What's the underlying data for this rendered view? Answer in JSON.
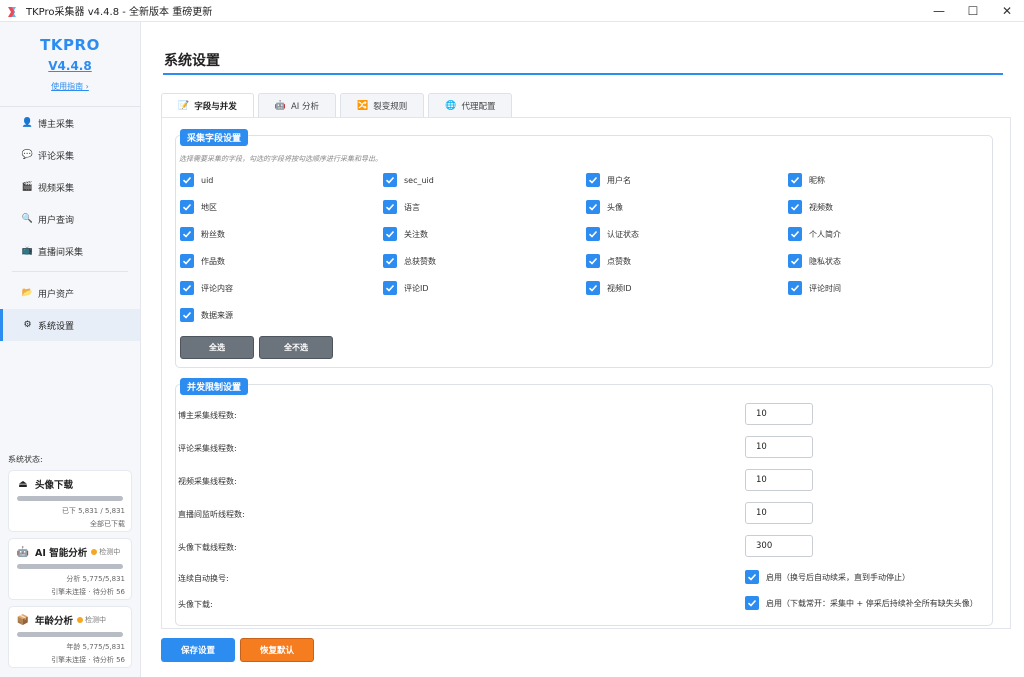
{
  "window": {
    "title": "TKPro采集器 v4.4.8 - 全新版本 重磅更新",
    "controls": {
      "minimize": "—",
      "maximize": "☐",
      "close": "✕"
    }
  },
  "sidebar": {
    "brand": "TKPRO",
    "version": "V4.4.8",
    "guide_link": "使用指南 ›",
    "items": [
      {
        "label": "博主采集",
        "icon": "user-icon"
      },
      {
        "label": "评论采集",
        "icon": "comment-icon"
      },
      {
        "label": "视频采集",
        "icon": "video-icon"
      },
      {
        "label": "用户查询",
        "icon": "search-icon"
      },
      {
        "label": "直播间采集",
        "icon": "live-icon"
      },
      {
        "label": "用户资产",
        "icon": "assets-icon"
      },
      {
        "label": "系统设置",
        "icon": "settings-icon",
        "active": true
      }
    ],
    "status_title": "系统状态:",
    "cards": [
      {
        "title": "头像下载",
        "icon": "download-icon",
        "line1": "已下 5,831 / 5,831",
        "line2": "全部已下载"
      },
      {
        "title": "AI 智能分析",
        "icon": "ai-icon",
        "badge": "检测中",
        "line1": "分析 5,775/5,831",
        "line2": "引擎未连接 · 待分析 56"
      },
      {
        "title": "年龄分析",
        "icon": "age-icon",
        "badge": "检测中",
        "line1": "年龄 5,775/5,831",
        "line2": "引擎未连接 · 待分析 56"
      }
    ]
  },
  "main": {
    "title": "系统设置",
    "tabs": [
      {
        "label": "字段与并发",
        "icon": "fields-icon",
        "active": true
      },
      {
        "label": "AI 分析",
        "icon": "ai-tab-icon"
      },
      {
        "label": "裂变规则",
        "icon": "fission-icon"
      },
      {
        "label": "代理配置",
        "icon": "globe-icon"
      }
    ],
    "fields_section": {
      "title": "采集字段设置",
      "hint": "选择需要采集的字段，勾选的字段将按勾选顺序进行采集和导出。",
      "fields": [
        "uid",
        "sec_uid",
        "用户名",
        "昵称",
        "地区",
        "语言",
        "头像",
        "视频数",
        "粉丝数",
        "关注数",
        "认证状态",
        "个人简介",
        "作品数",
        "总获赞数",
        "点赞数",
        "隐私状态",
        "评论内容",
        "评论ID",
        "视频ID",
        "评论时间",
        "数据来源"
      ],
      "select_all": "全选",
      "select_none": "全不选"
    },
    "concurrency_section": {
      "title": "并发限制设置",
      "rows": [
        {
          "label": "博主采集线程数:",
          "value": "10"
        },
        {
          "label": "评论采集线程数:",
          "value": "10"
        },
        {
          "label": "视频采集线程数:",
          "value": "10"
        },
        {
          "label": "直播间监听线程数:",
          "value": "10"
        },
        {
          "label": "头像下载线程数:",
          "value": "300"
        }
      ],
      "toggles": [
        {
          "label": "连续自动换号:",
          "text": "启用（换号后自动续采，直到手动停止）"
        },
        {
          "label": "头像下载:",
          "text": "启用（下载常开：采集中 + 停采后持续补全所有缺失头像）"
        }
      ]
    },
    "save_button": "保存设置",
    "reset_button": "恢复默认"
  }
}
